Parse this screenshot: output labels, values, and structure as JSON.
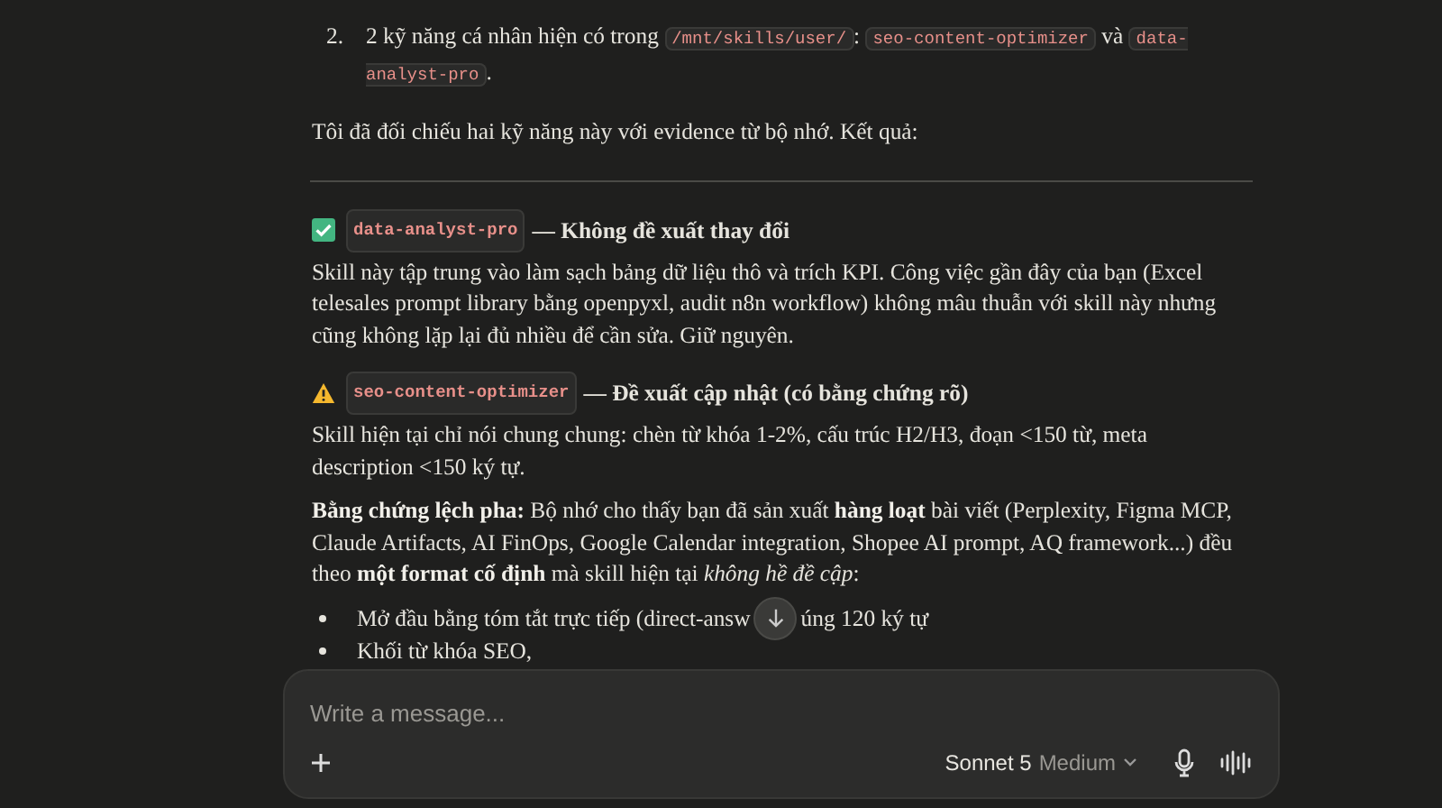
{
  "list_item": {
    "number": "2.",
    "segments": [
      {
        "kind": "text",
        "text": "2 kỹ năng cá nhân hiện có trong "
      },
      {
        "kind": "code",
        "text": "/mnt/skills/user/"
      },
      {
        "kind": "text",
        "text": ": "
      },
      {
        "kind": "code",
        "text": "seo-content-optimizer"
      },
      {
        "kind": "text",
        "text": " và "
      },
      {
        "kind": "code",
        "text": "data-analyst-pro"
      },
      {
        "kind": "text",
        "text": "."
      }
    ]
  },
  "intro": "Tôi đã đối chiếu hai kỹ năng này với evidence từ bộ nhớ. Kết quả:",
  "sections": [
    {
      "kind": "ok",
      "code": "data-analyst-pro",
      "title": "— Không đề xuất thay đổi",
      "paragraphs": [
        "Skill này tập trung vào làm sạch bảng dữ liệu thô và trích KPI. Công việc gần đây của bạn (Excel telesales prompt library bằng openpyxl, audit n8n workflow) không mâu thuẫn với skill này nhưng cũng không lặp lại đủ nhiều để cần sửa. Giữ nguyên."
      ]
    },
    {
      "kind": "warning",
      "code": "seo-content-optimizer",
      "title": "— Đề xuất cập nhật (có bằng chứng rõ)",
      "paragraphs": [
        "Skill hiện tại chỉ nói chung chung: chèn từ khóa 1-2%, cấu trúc H2/H3, đoạn <150 từ, meta description <150 ký tự.",
        "**Bằng chứng lệch pha:** Bộ nhớ cho thấy bạn đã sản xuất **hàng loạt** bài viết (Perplexity, Figma MCP, Claude Artifacts, AI FinOps, Google Calendar integration, Shopee AI prompt, AQ framework...) đều theo **một format cố định** mà skill hiện tại *không hề đề cập*:"
      ],
      "bullets": [
        [
          "Mở đầu bằng tóm tắt trực tiếp (direct-answ",
          "úng 120 ký tự"
        ],
        [
          "Khối từ khóa SEO,"
        ]
      ]
    }
  ],
  "composer": {
    "placeholder": "Write a message...",
    "model": "Sonnet 5",
    "effort": "Medium"
  }
}
